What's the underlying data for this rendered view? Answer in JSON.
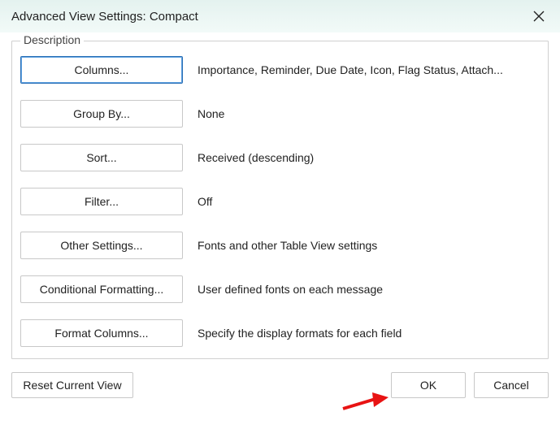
{
  "titlebar": {
    "title": "Advanced View Settings: Compact"
  },
  "fieldset": {
    "legend": "Description"
  },
  "rows": {
    "columns": {
      "button": "Columns...",
      "desc": "Importance, Reminder, Due Date, Icon, Flag Status, Attach..."
    },
    "groupby": {
      "button": "Group By...",
      "desc": "None"
    },
    "sort": {
      "button": "Sort...",
      "desc": "Received (descending)"
    },
    "filter": {
      "button": "Filter...",
      "desc": "Off"
    },
    "other": {
      "button": "Other Settings...",
      "desc": "Fonts and other Table View settings"
    },
    "condfmt": {
      "button": "Conditional Formatting...",
      "desc": "User defined fonts on each message"
    },
    "fmtcols": {
      "button": "Format Columns...",
      "desc": "Specify the display formats for each field"
    }
  },
  "footer": {
    "reset": "Reset Current View",
    "ok": "OK",
    "cancel": "Cancel"
  }
}
